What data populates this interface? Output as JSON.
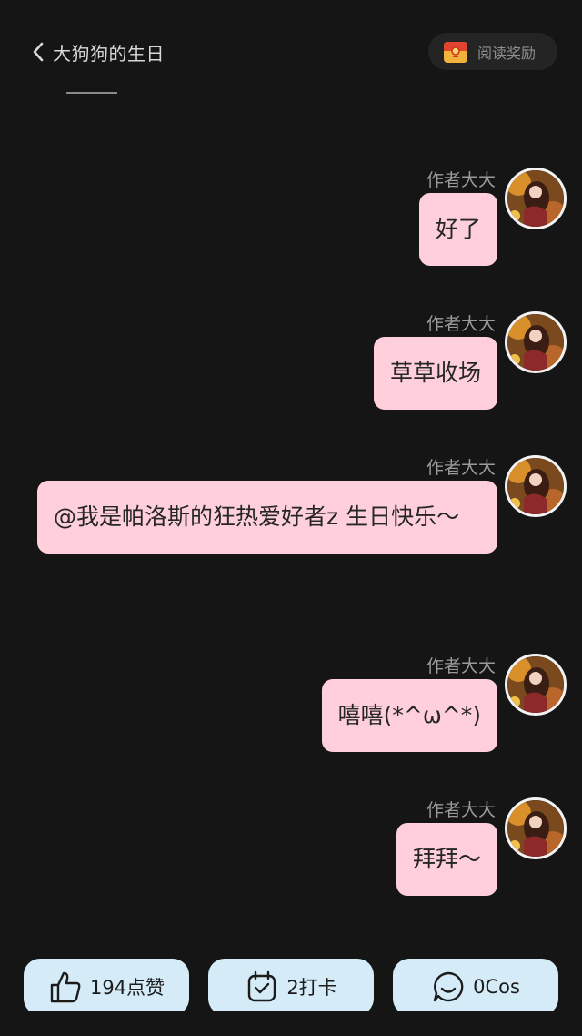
{
  "header": {
    "title": "大狗狗的生日",
    "reward_label": "阅读奖励"
  },
  "messages": [
    {
      "author": "作者大大",
      "text": "好了"
    },
    {
      "author": "作者大大",
      "text": "草草收场"
    },
    {
      "author": "作者大大",
      "text": "@我是帕洛斯的狂热爱好者z 生日快乐～"
    },
    {
      "author": "作者大大",
      "text": "嘻嘻(*^ω^*)"
    },
    {
      "author": "作者大大",
      "text": "拜拜～"
    }
  ],
  "actions": {
    "like_label": "194点赞",
    "checkin_label": "2打卡",
    "cos_label": "0Cos"
  },
  "icons": {
    "back": "chevron-left-icon",
    "reward": "gift-icon",
    "like": "thumbs-up-icon",
    "checkin": "calendar-check-icon",
    "cos": "chat-smile-icon"
  },
  "colors": {
    "background": "#151515",
    "bubble": "#ffd0dc",
    "action_bar": "#d5ebf7"
  }
}
